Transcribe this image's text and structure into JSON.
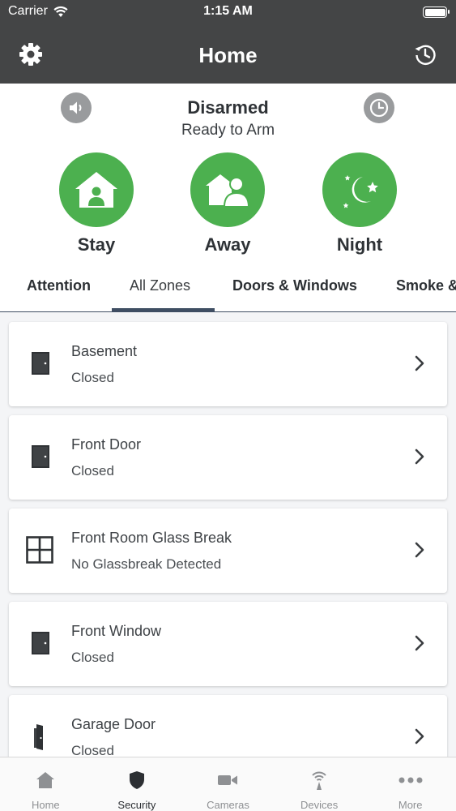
{
  "status_bar": {
    "carrier": "Carrier",
    "time": "1:15 AM"
  },
  "nav": {
    "title": "Home",
    "left_icon": "gear-icon",
    "right_icon": "history-icon"
  },
  "arm_panel": {
    "status": "Disarmed",
    "substatus": "Ready to Arm",
    "left_icon": "speaker-icon",
    "right_icon": "clock-icon",
    "accent_color": "#4cb04f",
    "buttons": [
      {
        "label": "Stay",
        "icon": "stay-house-person-icon"
      },
      {
        "label": "Away",
        "icon": "away-house-people-icon"
      },
      {
        "label": "Night",
        "icon": "moon-stars-icon"
      }
    ]
  },
  "tabs": [
    {
      "label": "Attention"
    },
    {
      "label": "All Zones",
      "active": true
    },
    {
      "label": "Doors & Windows"
    },
    {
      "label": "Smoke &"
    }
  ],
  "zones": [
    {
      "name": "Basement",
      "state": "Closed",
      "icon": "door-icon"
    },
    {
      "name": "Front Door",
      "state": "Closed",
      "icon": "door-icon"
    },
    {
      "name": "Front Room Glass Break",
      "state": "No Glassbreak Detected",
      "icon": "window-grid-icon"
    },
    {
      "name": "Front Window",
      "state": "Closed",
      "icon": "door-icon"
    },
    {
      "name": "Garage Door",
      "state": "Closed",
      "icon": "door-side-icon"
    }
  ],
  "tab_bar": [
    {
      "label": "Home",
      "icon": "home-icon"
    },
    {
      "label": "Security",
      "icon": "shield-icon",
      "active": true
    },
    {
      "label": "Cameras",
      "icon": "video-camera-icon"
    },
    {
      "label": "Devices",
      "icon": "wireless-device-icon"
    },
    {
      "label": "More",
      "icon": "more-dots-icon"
    }
  ]
}
